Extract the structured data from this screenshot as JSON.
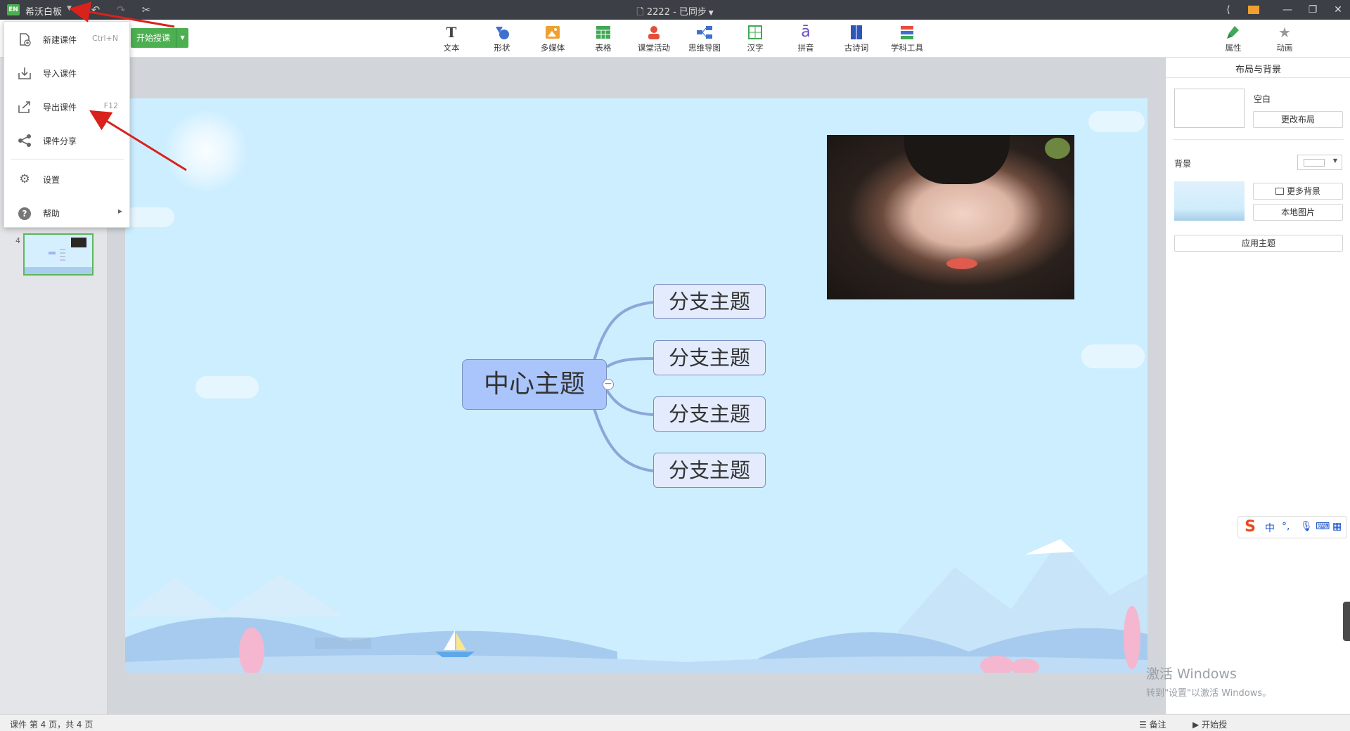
{
  "titlebar": {
    "logo": "EN",
    "app_name": "希沃白板",
    "document": "2222 - 已同步"
  },
  "toolbar": {
    "start_label": "开始授课",
    "tools": [
      {
        "label": "文本",
        "icon": "text-icon"
      },
      {
        "label": "形状",
        "icon": "shape-icon"
      },
      {
        "label": "多媒体",
        "icon": "media-icon"
      },
      {
        "label": "表格",
        "icon": "table-icon"
      },
      {
        "label": "课堂活动",
        "icon": "class-activity-icon"
      },
      {
        "label": "思维导图",
        "icon": "mindmap-icon"
      },
      {
        "label": "汉字",
        "icon": "hanzi-icon"
      },
      {
        "label": "拼音",
        "icon": "pinyin-icon"
      },
      {
        "label": "古诗词",
        "icon": "poem-icon"
      },
      {
        "label": "学科工具",
        "icon": "subject-tools-icon"
      }
    ],
    "right_tools": [
      {
        "label": "属性",
        "icon": "brush-icon"
      },
      {
        "label": "动画",
        "icon": "star-icon"
      }
    ]
  },
  "app_menu": {
    "items": [
      {
        "label": "新建课件",
        "shortcut": "Ctrl+N",
        "icon": "new-file-icon"
      },
      {
        "label": "导入课件",
        "shortcut": "",
        "icon": "import-icon"
      },
      {
        "label": "导出课件",
        "shortcut": "F12",
        "icon": "export-icon"
      },
      {
        "label": "课件分享",
        "shortcut": "",
        "icon": "share-icon"
      },
      {
        "label": "设置",
        "shortcut": "",
        "icon": "gear-icon"
      },
      {
        "label": "帮助",
        "shortcut": "",
        "icon": "help-icon"
      }
    ]
  },
  "slides": {
    "current_number": "4"
  },
  "mindmap": {
    "center": "中心主题",
    "branches": [
      "分支主题",
      "分支主题",
      "分支主题",
      "分支主题"
    ]
  },
  "right_panel": {
    "title": "布局与背景",
    "layout_name": "空白",
    "change_layout": "更改布局",
    "background_label": "背景",
    "more_bg": "更多背景",
    "local_image": "本地图片",
    "apply_theme": "应用主题"
  },
  "statusbar": {
    "page_info": "课件 第 4 页，共 4 页",
    "notes": "备注",
    "start": "开始授"
  },
  "watermark": {
    "line1": "激活 Windows",
    "line2": "转到\"设置\"以激活 Windows。"
  },
  "ime": {
    "lang": "中"
  },
  "colors": {
    "accent_green": "#4caf50",
    "titlebar": "#3c3f45",
    "slide_bg": "#cdeeff",
    "center_node": "#a9c5fb",
    "branch_node": "#e3ebfc",
    "annotation_arrow": "#d9221c"
  }
}
